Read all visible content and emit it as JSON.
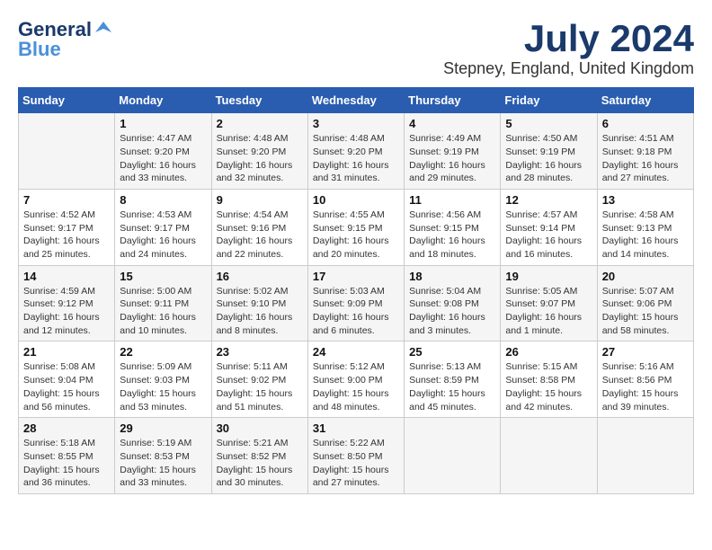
{
  "header": {
    "logo_line1": "General",
    "logo_line2": "Blue",
    "month_year": "July 2024",
    "location": "Stepney, England, United Kingdom"
  },
  "weekdays": [
    "Sunday",
    "Monday",
    "Tuesday",
    "Wednesday",
    "Thursday",
    "Friday",
    "Saturday"
  ],
  "weeks": [
    [
      {
        "day": "",
        "info": ""
      },
      {
        "day": "1",
        "info": "Sunrise: 4:47 AM\nSunset: 9:20 PM\nDaylight: 16 hours\nand 33 minutes."
      },
      {
        "day": "2",
        "info": "Sunrise: 4:48 AM\nSunset: 9:20 PM\nDaylight: 16 hours\nand 32 minutes."
      },
      {
        "day": "3",
        "info": "Sunrise: 4:48 AM\nSunset: 9:20 PM\nDaylight: 16 hours\nand 31 minutes."
      },
      {
        "day": "4",
        "info": "Sunrise: 4:49 AM\nSunset: 9:19 PM\nDaylight: 16 hours\nand 29 minutes."
      },
      {
        "day": "5",
        "info": "Sunrise: 4:50 AM\nSunset: 9:19 PM\nDaylight: 16 hours\nand 28 minutes."
      },
      {
        "day": "6",
        "info": "Sunrise: 4:51 AM\nSunset: 9:18 PM\nDaylight: 16 hours\nand 27 minutes."
      }
    ],
    [
      {
        "day": "7",
        "info": "Sunrise: 4:52 AM\nSunset: 9:17 PM\nDaylight: 16 hours\nand 25 minutes."
      },
      {
        "day": "8",
        "info": "Sunrise: 4:53 AM\nSunset: 9:17 PM\nDaylight: 16 hours\nand 24 minutes."
      },
      {
        "day": "9",
        "info": "Sunrise: 4:54 AM\nSunset: 9:16 PM\nDaylight: 16 hours\nand 22 minutes."
      },
      {
        "day": "10",
        "info": "Sunrise: 4:55 AM\nSunset: 9:15 PM\nDaylight: 16 hours\nand 20 minutes."
      },
      {
        "day": "11",
        "info": "Sunrise: 4:56 AM\nSunset: 9:15 PM\nDaylight: 16 hours\nand 18 minutes."
      },
      {
        "day": "12",
        "info": "Sunrise: 4:57 AM\nSunset: 9:14 PM\nDaylight: 16 hours\nand 16 minutes."
      },
      {
        "day": "13",
        "info": "Sunrise: 4:58 AM\nSunset: 9:13 PM\nDaylight: 16 hours\nand 14 minutes."
      }
    ],
    [
      {
        "day": "14",
        "info": "Sunrise: 4:59 AM\nSunset: 9:12 PM\nDaylight: 16 hours\nand 12 minutes."
      },
      {
        "day": "15",
        "info": "Sunrise: 5:00 AM\nSunset: 9:11 PM\nDaylight: 16 hours\nand 10 minutes."
      },
      {
        "day": "16",
        "info": "Sunrise: 5:02 AM\nSunset: 9:10 PM\nDaylight: 16 hours\nand 8 minutes."
      },
      {
        "day": "17",
        "info": "Sunrise: 5:03 AM\nSunset: 9:09 PM\nDaylight: 16 hours\nand 6 minutes."
      },
      {
        "day": "18",
        "info": "Sunrise: 5:04 AM\nSunset: 9:08 PM\nDaylight: 16 hours\nand 3 minutes."
      },
      {
        "day": "19",
        "info": "Sunrise: 5:05 AM\nSunset: 9:07 PM\nDaylight: 16 hours\nand 1 minute."
      },
      {
        "day": "20",
        "info": "Sunrise: 5:07 AM\nSunset: 9:06 PM\nDaylight: 15 hours\nand 58 minutes."
      }
    ],
    [
      {
        "day": "21",
        "info": "Sunrise: 5:08 AM\nSunset: 9:04 PM\nDaylight: 15 hours\nand 56 minutes."
      },
      {
        "day": "22",
        "info": "Sunrise: 5:09 AM\nSunset: 9:03 PM\nDaylight: 15 hours\nand 53 minutes."
      },
      {
        "day": "23",
        "info": "Sunrise: 5:11 AM\nSunset: 9:02 PM\nDaylight: 15 hours\nand 51 minutes."
      },
      {
        "day": "24",
        "info": "Sunrise: 5:12 AM\nSunset: 9:00 PM\nDaylight: 15 hours\nand 48 minutes."
      },
      {
        "day": "25",
        "info": "Sunrise: 5:13 AM\nSunset: 8:59 PM\nDaylight: 15 hours\nand 45 minutes."
      },
      {
        "day": "26",
        "info": "Sunrise: 5:15 AM\nSunset: 8:58 PM\nDaylight: 15 hours\nand 42 minutes."
      },
      {
        "day": "27",
        "info": "Sunrise: 5:16 AM\nSunset: 8:56 PM\nDaylight: 15 hours\nand 39 minutes."
      }
    ],
    [
      {
        "day": "28",
        "info": "Sunrise: 5:18 AM\nSunset: 8:55 PM\nDaylight: 15 hours\nand 36 minutes."
      },
      {
        "day": "29",
        "info": "Sunrise: 5:19 AM\nSunset: 8:53 PM\nDaylight: 15 hours\nand 33 minutes."
      },
      {
        "day": "30",
        "info": "Sunrise: 5:21 AM\nSunset: 8:52 PM\nDaylight: 15 hours\nand 30 minutes."
      },
      {
        "day": "31",
        "info": "Sunrise: 5:22 AM\nSunset: 8:50 PM\nDaylight: 15 hours\nand 27 minutes."
      },
      {
        "day": "",
        "info": ""
      },
      {
        "day": "",
        "info": ""
      },
      {
        "day": "",
        "info": ""
      }
    ]
  ]
}
